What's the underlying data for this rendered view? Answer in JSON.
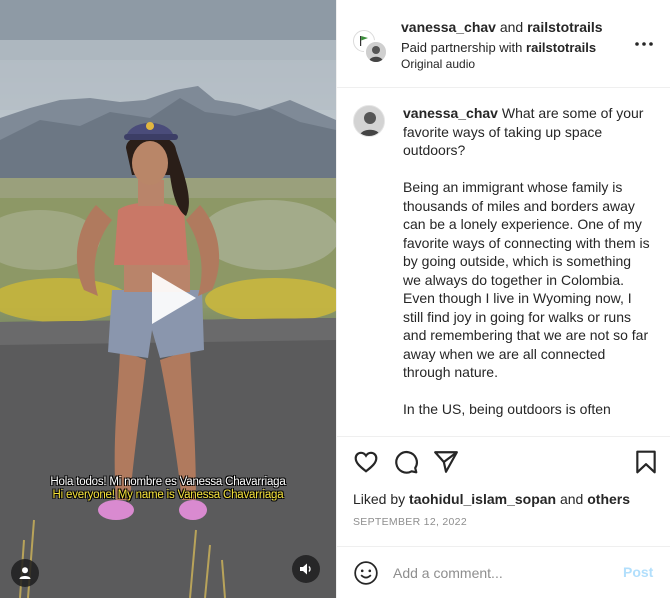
{
  "video": {
    "caption_es": "Hola todos! Mi nombre es Vanessa Chavarriaga",
    "caption_en": "Hi everyone! My name is Vanessa Chavarriaga"
  },
  "header": {
    "author": "vanessa_chav",
    "joiner": "and",
    "coauthor": "railstotrails",
    "partnership_prefix": "Paid partnership with",
    "partner": "railstotrails",
    "audio": "Original audio"
  },
  "caption": {
    "username": "vanessa_chav",
    "paragraphs": [
      "What are some of your favorite ways of taking up space outdoors?",
      "Being an immigrant whose family is thousands of miles and borders away can be a lonely experience. One of my favorite ways of connecting with them is by going outside, which is something we always do together in Colombia. Even though I live in Wyoming now, I still find joy in going for walks or runs and remembering that we are not so far away when we are all connected through nature.",
      "In the US, being outdoors is often"
    ]
  },
  "likes": {
    "prefix": "Liked by",
    "user": "taohidul_islam_sopan",
    "joiner": "and",
    "others": "others"
  },
  "date": "SEPTEMBER 12, 2022",
  "comment": {
    "placeholder": "Add a comment...",
    "post_label": "Post"
  },
  "colors": {
    "post_disabled": "#b2dffc",
    "caption_en": "#f4e13a",
    "muted_text": "#8e8e8e"
  },
  "icons": [
    "play-icon",
    "user-tag-icon",
    "volume-icon",
    "more-icon",
    "heart-icon",
    "comment-icon",
    "share-icon",
    "bookmark-icon",
    "emoji-icon"
  ]
}
